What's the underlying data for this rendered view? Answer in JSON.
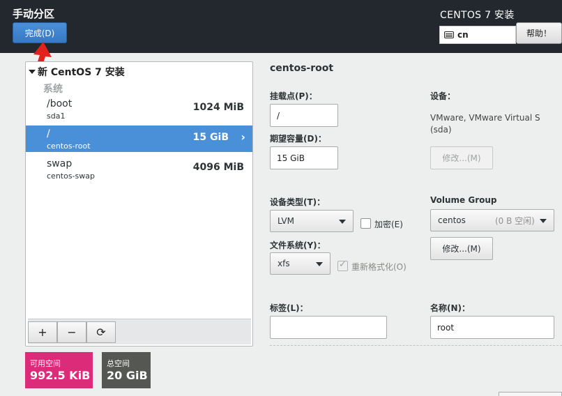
{
  "header": {
    "title": "手动分区",
    "done_label": "完成(D)",
    "product": "CENTOS 7 安装",
    "keyboard_layout": "cn",
    "help_label": "帮助！"
  },
  "left_panel": {
    "install_title": "新 CentOS 7 安装",
    "group_label": "系统",
    "mount_points": [
      {
        "name": "/boot",
        "device": "sda1",
        "size": "1024 MiB",
        "selected": false
      },
      {
        "name": "/",
        "device": "centos-root",
        "size": "15 GiB",
        "selected": true
      },
      {
        "name": "swap",
        "device": "centos-swap",
        "size": "4096 MiB",
        "selected": false
      }
    ],
    "toolbar": {
      "add_label": "+",
      "remove_label": "−",
      "refresh_label": "⟳"
    }
  },
  "space": {
    "available_label": "可用空间",
    "available_value": "992.5 KiB",
    "total_label": "总空间",
    "total_value": "20 GiB"
  },
  "details": {
    "title": "centos-root",
    "mount_point_label": "挂载点(P)：",
    "mount_point_value": "/",
    "desired_capacity_label": "期望容量(D)：",
    "desired_capacity_value": "15 GiB",
    "device_label": "设备：",
    "device_value_line1": "VMware, VMware Virtual S",
    "device_value_line2": "(sda)",
    "modify_device_label": "修改...(M)",
    "device_type_label": "设备类型(T)：",
    "device_type_value": "LVM",
    "encrypt_label": "加密(E)",
    "volume_group_label": "Volume Group",
    "volume_group_name": "centos",
    "volume_group_free": "(0 B 空闲)",
    "modify_vg_label": "修改...(M)",
    "filesystem_label": "文件系统(Y)：",
    "filesystem_value": "xfs",
    "reformat_label": "重新格式化(O)",
    "tag_label": "标签(L)：",
    "tag_value": "",
    "name_label": "名称(N)：",
    "name_value": "root"
  }
}
